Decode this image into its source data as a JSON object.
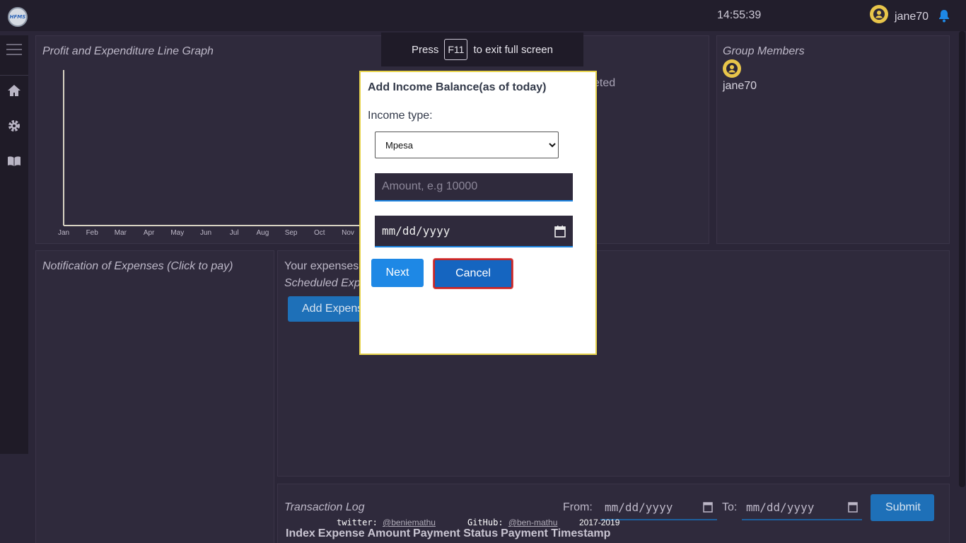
{
  "app": {
    "logo_text": "HFMS",
    "clock": "14:55:39",
    "username": "jane70"
  },
  "fullscreen_hint": {
    "press": "Press",
    "key": "F11",
    "suffix": "to exit full screen"
  },
  "chart_panel": {
    "title": "Profit and Expenditure Line Graph",
    "months": [
      "Jan",
      "Feb",
      "Mar",
      "Apr",
      "May",
      "Jun",
      "Jul",
      "Aug",
      "Sep",
      "Oct",
      "Nov"
    ],
    "partial_text": "eted"
  },
  "chart_data": {
    "type": "line",
    "x": [
      "Jan",
      "Feb",
      "Mar",
      "Apr",
      "May",
      "Jun",
      "Jul",
      "Aug",
      "Sep",
      "Oct",
      "Nov"
    ],
    "series": [],
    "title": "Profit and Expenditure Line Graph",
    "grid": false
  },
  "group_panel": {
    "title": "Group Members",
    "members": [
      "jane70"
    ]
  },
  "notifications_panel": {
    "title": "Notification of Expenses (Click to pay)"
  },
  "expenses_panel": {
    "your_expenses": "Your expenses",
    "scheduled": "Scheduled Expe",
    "add_button": "Add Expens"
  },
  "transaction_log": {
    "title": "Transaction Log",
    "from_label": "From:",
    "to_label": "To:",
    "from_value": "mm/dd/yyyy",
    "to_value": "mm/dd/yyyy",
    "submit": "Submit",
    "columns": [
      "Index",
      "Expense",
      "Amount",
      "Payment Status",
      "Payment Timestamp"
    ]
  },
  "footer": {
    "twitter_label": "twitter:",
    "twitter_handle": "@beniemathu",
    "github_label": "GitHub:",
    "github_handle": "@ben-mathu",
    "years": "2017-2019"
  },
  "modal": {
    "title": "Add Income Balance(as of today)",
    "income_type_label": "Income type:",
    "income_type_selected": "Mpesa",
    "amount_placeholder": "Amount, e.g 10000",
    "date_value": "mm/dd/yyyy",
    "next": "Next",
    "cancel": "Cancel"
  },
  "colors": {
    "accent": "#1e88e5",
    "modal_border": "#e8d44d",
    "cancel_outline": "#c62828",
    "avatar": "#e8c54a"
  }
}
